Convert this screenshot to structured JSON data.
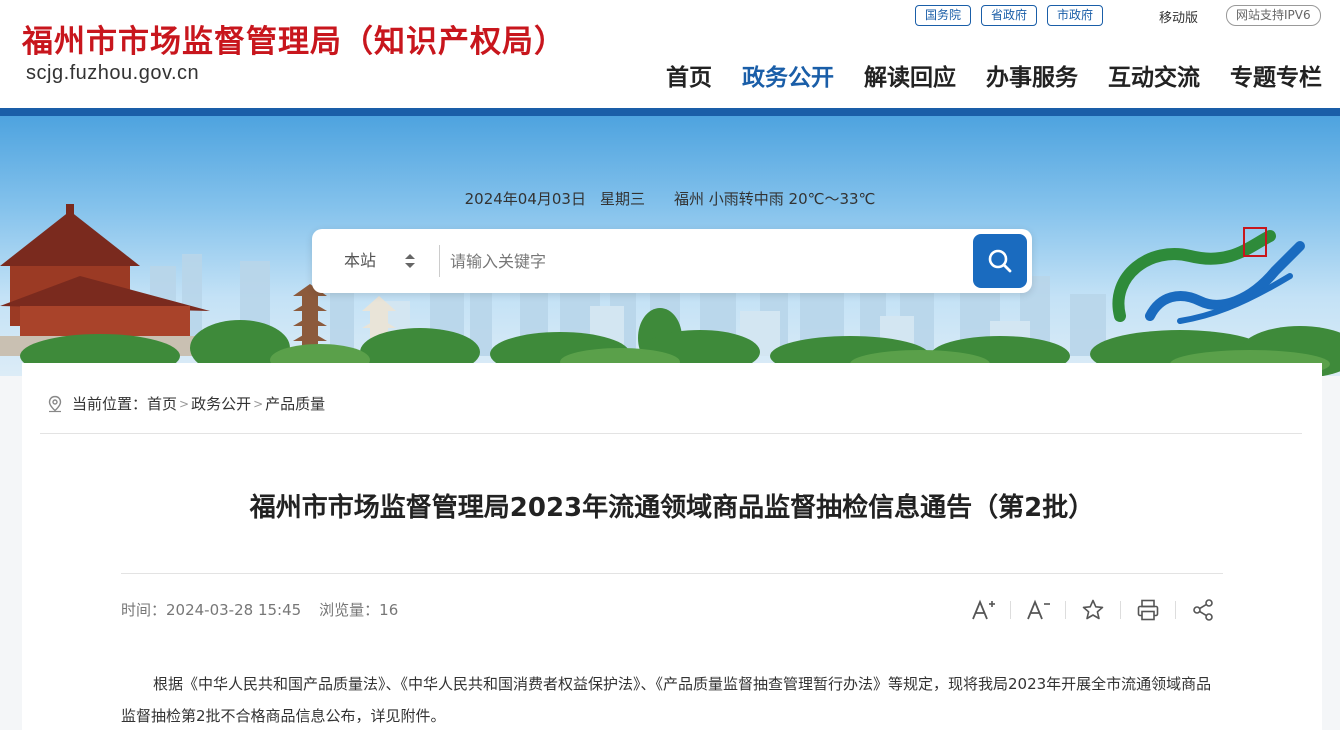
{
  "header": {
    "site_title": "福州市市场监督管理局（知识产权局）",
    "site_url": "scjg.fuzhou.gov.cn",
    "top_links": [
      "国务院",
      "省政府",
      "市政府"
    ],
    "mobile_label": "移动版",
    "ipv6_label": "网站支持IPV6",
    "nav": [
      "首页",
      "政务公开",
      "解读回应",
      "办事服务",
      "互动交流",
      "专题专栏"
    ],
    "active_nav": "政务公开"
  },
  "banner": {
    "date": "2024年04月03日",
    "weekday": "星期三",
    "weather": "福州 小雨转中雨 20℃～33℃",
    "search_scope": "本站",
    "search_placeholder": "请输入关键字"
  },
  "breadcrumb": {
    "label": "当前位置：",
    "items": [
      "首页",
      "政务公开",
      "产品质量"
    ]
  },
  "article": {
    "title": "福州市市场监督管理局2023年流通领域商品监督抽检信息通告（第2批）",
    "time": "时间：2024-03-28 15:45",
    "views": "浏览量：16",
    "body": "根据《中华人民共和国产品质量法》、《中华人民共和国消费者权益保护法》、《产品质量监督抽查管理暂行办法》等规定，现将我局2023年开展全市流通领域商品监督抽检第2批不合格商品信息公布，详见附件。"
  },
  "tools": [
    "font-increase-icon",
    "font-decrease-icon",
    "favorite-star-icon",
    "print-icon",
    "share-icon"
  ],
  "colors": {
    "brand_red": "#c8161d",
    "brand_blue": "#1a5ea8",
    "search_button": "#1a6bbf"
  }
}
